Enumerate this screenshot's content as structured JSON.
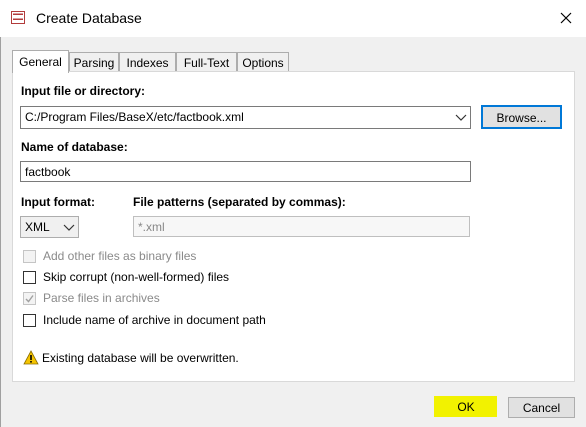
{
  "window": {
    "title": "Create Database",
    "icon": "basex-app-icon",
    "close_icon": "close-icon"
  },
  "tabs": [
    {
      "label": "General",
      "active": true
    },
    {
      "label": "Parsing",
      "active": false
    },
    {
      "label": "Indexes",
      "active": false
    },
    {
      "label": "Full-Text",
      "active": false
    },
    {
      "label": "Options",
      "active": false
    }
  ],
  "general": {
    "input_label": "Input file or directory:",
    "input_value": "C:/Program Files/BaseX/etc/factbook.xml",
    "browse_label": "Browse...",
    "name_label": "Name of database:",
    "name_value": "factbook",
    "format_label": "Input format:",
    "format_value": "XML",
    "patterns_label": "File patterns (separated by commas):",
    "patterns_value": "*.xml"
  },
  "checkboxes": [
    {
      "label": "Add other files as binary files",
      "checked": false,
      "enabled": false
    },
    {
      "label": "Skip corrupt (non-well-formed) files",
      "checked": false,
      "enabled": true
    },
    {
      "label": "Parse files in archives",
      "checked": true,
      "enabled": false
    },
    {
      "label": "Include name of archive in document path",
      "checked": false,
      "enabled": true
    }
  ],
  "status": {
    "icon": "warning-icon",
    "text": "Existing database will be overwritten."
  },
  "buttons": {
    "ok": "OK",
    "cancel": "Cancel"
  },
  "colors": {
    "highlight": "#f2f200",
    "focus": "#0078d7",
    "warning": "#f5c400"
  }
}
